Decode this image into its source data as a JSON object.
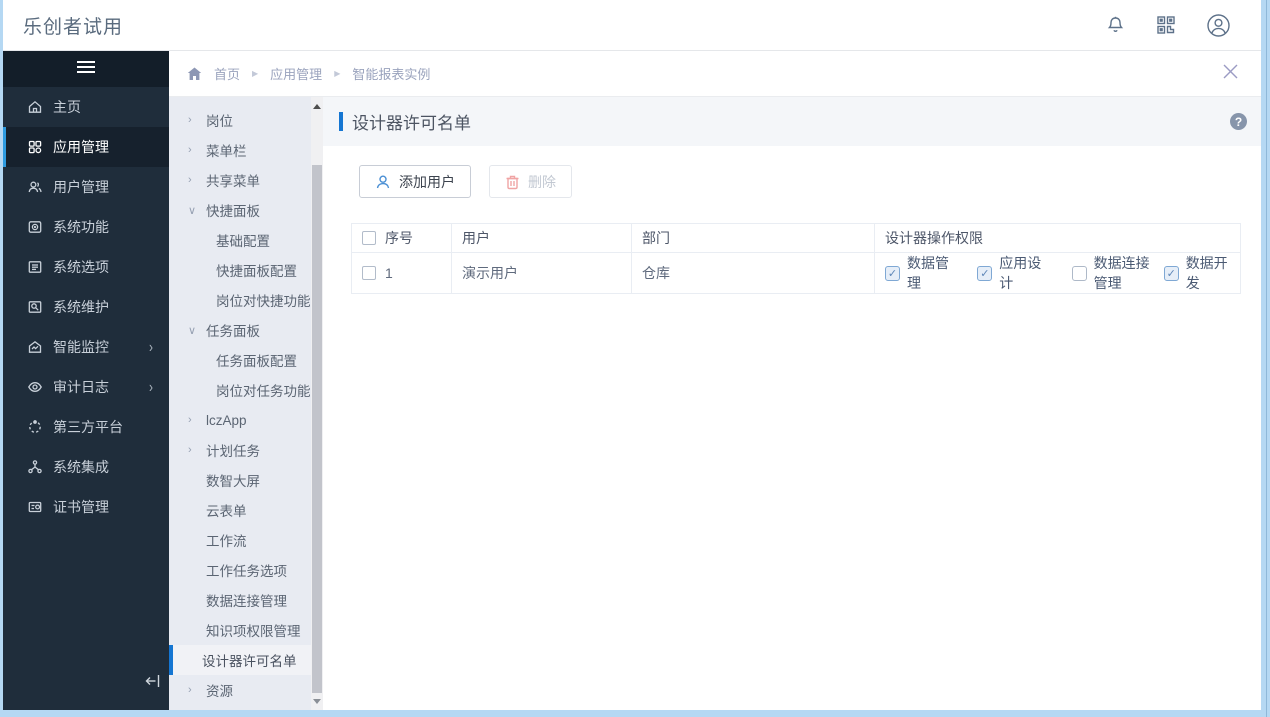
{
  "topbar": {
    "logo": "乐创者试用",
    "icons": [
      "bell-icon",
      "qr-code-icon",
      "user-avatar-icon"
    ]
  },
  "breadcrumb": {
    "home_icon": "home-icon",
    "items": [
      "首页",
      "应用管理",
      "智能报表实例"
    ],
    "close_icon": "close-icon"
  },
  "sidebar": {
    "items": [
      {
        "label": "主页",
        "icon": "home-icon",
        "selected": false,
        "has_arrow": false
      },
      {
        "label": "应用管理",
        "icon": "apps-grid-icon",
        "selected": true,
        "has_arrow": false
      },
      {
        "label": "用户管理",
        "icon": "users-icon",
        "selected": false,
        "has_arrow": false
      },
      {
        "label": "系统功能",
        "icon": "monitor-icon",
        "selected": false,
        "has_arrow": false
      },
      {
        "label": "系统选项",
        "icon": "options-doc-icon",
        "selected": false,
        "has_arrow": false
      },
      {
        "label": "系统维护",
        "icon": "maintenance-icon",
        "selected": false,
        "has_arrow": false
      },
      {
        "label": "智能监控",
        "icon": "smart-monitor-icon",
        "selected": false,
        "has_arrow": true
      },
      {
        "label": "审计日志",
        "icon": "eye-icon",
        "selected": false,
        "has_arrow": true
      },
      {
        "label": "第三方平台",
        "icon": "third-party-icon",
        "selected": false,
        "has_arrow": false
      },
      {
        "label": "系统集成",
        "icon": "integration-icon",
        "selected": false,
        "has_arrow": false
      },
      {
        "label": "证书管理",
        "icon": "certificate-icon",
        "selected": false,
        "has_arrow": false
      }
    ],
    "arrow_glyph": "›"
  },
  "submenu": {
    "items": [
      {
        "label": "岗位",
        "chevron": "›"
      },
      {
        "label": "菜单栏",
        "chevron": "›"
      },
      {
        "label": "共享菜单",
        "chevron": "›"
      },
      {
        "label": "快捷面板",
        "chevron": "∨"
      },
      {
        "label": "基础配置",
        "chevron": ""
      },
      {
        "label": "快捷面板配置",
        "chevron": ""
      },
      {
        "label": "岗位对快捷功能",
        "chevron": ""
      },
      {
        "label": "任务面板",
        "chevron": "∨"
      },
      {
        "label": "任务面板配置",
        "chevron": ""
      },
      {
        "label": "岗位对任务功能",
        "chevron": ""
      },
      {
        "label": "lczApp",
        "chevron": "›"
      },
      {
        "label": "计划任务",
        "chevron": "›"
      },
      {
        "label": "数智大屏",
        "chevron": ""
      },
      {
        "label": "云表单",
        "chevron": ""
      },
      {
        "label": "工作流",
        "chevron": ""
      },
      {
        "label": "工作任务选项",
        "chevron": ""
      },
      {
        "label": "数据连接管理",
        "chevron": ""
      },
      {
        "label": "知识项权限管理",
        "chevron": ""
      },
      {
        "label": "设计器许可名单",
        "chevron": "",
        "selected": true
      },
      {
        "label": "资源",
        "chevron": "›"
      }
    ]
  },
  "page": {
    "title": "设计器许可名单",
    "help_icon": "?"
  },
  "toolbar": {
    "add_user_label": "添加用户",
    "delete_label": "删除",
    "delete_disabled": true
  },
  "table": {
    "headers": [
      "序号",
      "用户",
      "部门",
      "设计器操作权限"
    ],
    "rows": [
      {
        "index": "1",
        "user": "演示用户",
        "dept": "仓库",
        "permissions": [
          {
            "label": "数据管理",
            "checked": true
          },
          {
            "label": "应用设计",
            "checked": true
          },
          {
            "label": "数据连接管理",
            "checked": false
          },
          {
            "label": "数据开发",
            "checked": true
          }
        ]
      }
    ]
  },
  "glyphs": {
    "check": "✓"
  },
  "colors": {
    "accent_blue": "#1576d2",
    "sidebar_bg": "#1f2d3b",
    "sidebar_selected_border": "#2e9be0",
    "submenu_bg": "#e8ebf2",
    "titlebar_bg": "#f4f6f9",
    "window_border": "#b5d8f3",
    "delete_icon_pink": "#f0a4a4",
    "add_user_icon_blue": "#4a8fd4"
  }
}
